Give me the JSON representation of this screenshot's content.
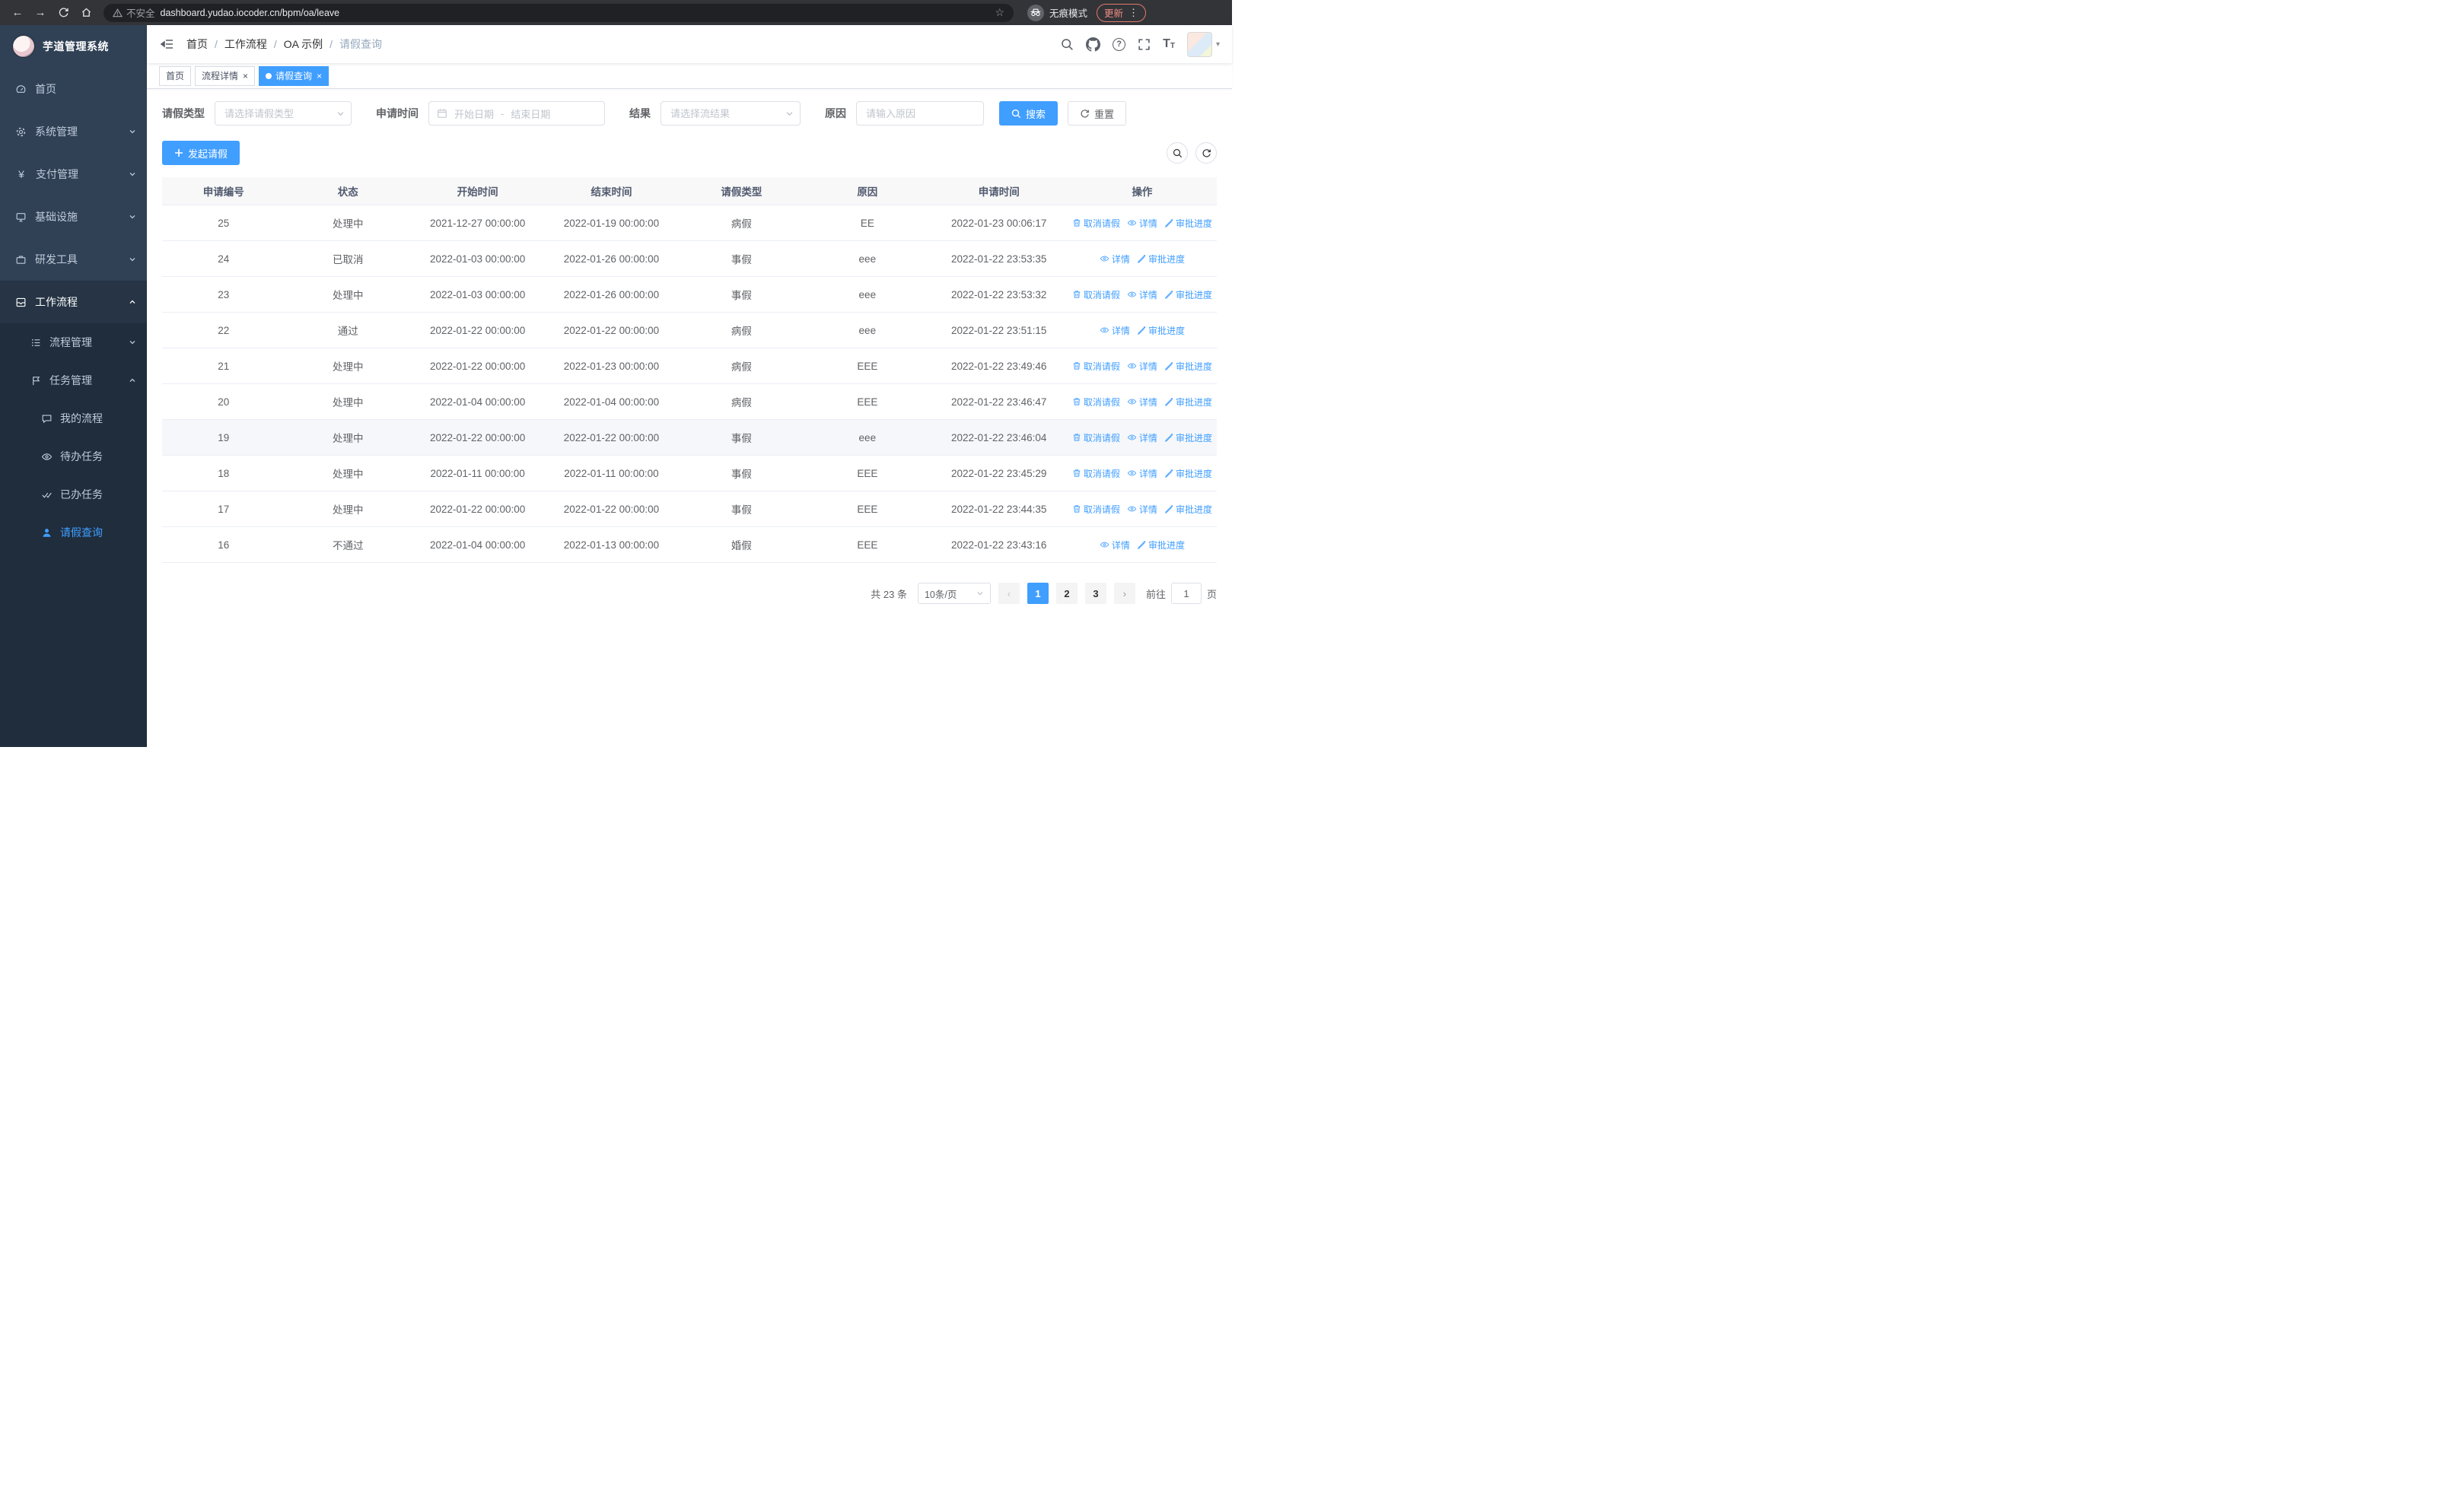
{
  "browser": {
    "security_label": "不安全",
    "url": "dashboard.yudao.iocoder.cn/bpm/oa/leave",
    "incognito_label": "无痕模式",
    "update_label": "更新"
  },
  "icons": {
    "back": "←",
    "forward": "→",
    "star": "☆",
    "menu_dots": "⋮",
    "close": "×",
    "yen": "¥",
    "question": "?",
    "font_large": "T",
    "font_small": "T",
    "avatar_caret": "▾",
    "prev_arrow": "‹",
    "next_arrow": "›"
  },
  "sidebar": {
    "logo_title": "芋道管理系统",
    "items": [
      {
        "label": "首页"
      },
      {
        "label": "系统管理"
      },
      {
        "label": "支付管理"
      },
      {
        "label": "基础设施"
      },
      {
        "label": "研发工具"
      },
      {
        "label": "工作流程"
      }
    ],
    "submenu": {
      "process_label": "流程管理",
      "task_label": "任务管理",
      "task_children": [
        {
          "label": "我的流程"
        },
        {
          "label": "待办任务"
        },
        {
          "label": "已办任务"
        },
        {
          "label": "请假查询"
        }
      ]
    }
  },
  "header": {
    "breadcrumb": [
      "首页",
      "工作流程",
      "OA 示例",
      "请假查询"
    ]
  },
  "tabs": [
    {
      "label": "首页"
    },
    {
      "label": "流程详情"
    },
    {
      "label": "请假查询"
    }
  ],
  "filters": {
    "leave_type_label": "请假类型",
    "leave_type_placeholder": "请选择请假类型",
    "apply_time_label": "申请时间",
    "start_placeholder": "开始日期",
    "range_separator": "-",
    "end_placeholder": "结束日期",
    "result_label": "结果",
    "result_placeholder": "请选择流结果",
    "reason_label": "原因",
    "reason_placeholder": "请输入原因",
    "search_button": "搜索",
    "reset_button": "重置"
  },
  "toolbar": {
    "create_button": "发起请假"
  },
  "table": {
    "headers": [
      "申请编号",
      "状态",
      "开始时间",
      "结束时间",
      "请假类型",
      "原因",
      "申请时间",
      "操作"
    ],
    "actions": {
      "cancel": "取消请假",
      "detail": "详情",
      "progress": "审批进度"
    },
    "rows": [
      {
        "id": "25",
        "status": "处理中",
        "start": "2021-12-27 00:00:00",
        "end": "2022-01-19 00:00:00",
        "type": "病假",
        "reason": "EE",
        "applied": "2022-01-23 00:06:17",
        "cancellable": true,
        "hover": false
      },
      {
        "id": "24",
        "status": "已取消",
        "start": "2022-01-03 00:00:00",
        "end": "2022-01-26 00:00:00",
        "type": "事假",
        "reason": "eee",
        "applied": "2022-01-22 23:53:35",
        "cancellable": false,
        "hover": false
      },
      {
        "id": "23",
        "status": "处理中",
        "start": "2022-01-03 00:00:00",
        "end": "2022-01-26 00:00:00",
        "type": "事假",
        "reason": "eee",
        "applied": "2022-01-22 23:53:32",
        "cancellable": true,
        "hover": false
      },
      {
        "id": "22",
        "status": "通过",
        "start": "2022-01-22 00:00:00",
        "end": "2022-01-22 00:00:00",
        "type": "病假",
        "reason": "eee",
        "applied": "2022-01-22 23:51:15",
        "cancellable": false,
        "hover": false
      },
      {
        "id": "21",
        "status": "处理中",
        "start": "2022-01-22 00:00:00",
        "end": "2022-01-23 00:00:00",
        "type": "病假",
        "reason": "EEE",
        "applied": "2022-01-22 23:49:46",
        "cancellable": true,
        "hover": false
      },
      {
        "id": "20",
        "status": "处理中",
        "start": "2022-01-04 00:00:00",
        "end": "2022-01-04 00:00:00",
        "type": "病假",
        "reason": "EEE",
        "applied": "2022-01-22 23:46:47",
        "cancellable": true,
        "hover": false
      },
      {
        "id": "19",
        "status": "处理中",
        "start": "2022-01-22 00:00:00",
        "end": "2022-01-22 00:00:00",
        "type": "事假",
        "reason": "eee",
        "applied": "2022-01-22 23:46:04",
        "cancellable": true,
        "hover": true
      },
      {
        "id": "18",
        "status": "处理中",
        "start": "2022-01-11 00:00:00",
        "end": "2022-01-11 00:00:00",
        "type": "事假",
        "reason": "EEE",
        "applied": "2022-01-22 23:45:29",
        "cancellable": true,
        "hover": false
      },
      {
        "id": "17",
        "status": "处理中",
        "start": "2022-01-22 00:00:00",
        "end": "2022-01-22 00:00:00",
        "type": "事假",
        "reason": "EEE",
        "applied": "2022-01-22 23:44:35",
        "cancellable": true,
        "hover": false
      },
      {
        "id": "16",
        "status": "不通过",
        "start": "2022-01-04 00:00:00",
        "end": "2022-01-13 00:00:00",
        "type": "婚假",
        "reason": "EEE",
        "applied": "2022-01-22 23:43:16",
        "cancellable": false,
        "hover": false
      }
    ]
  },
  "pagination": {
    "total_text": "共 23 条",
    "page_size": "10条/页",
    "pages": [
      "1",
      "2",
      "3"
    ],
    "goto_label": "前往",
    "goto_value": "1",
    "goto_suffix": "页"
  }
}
